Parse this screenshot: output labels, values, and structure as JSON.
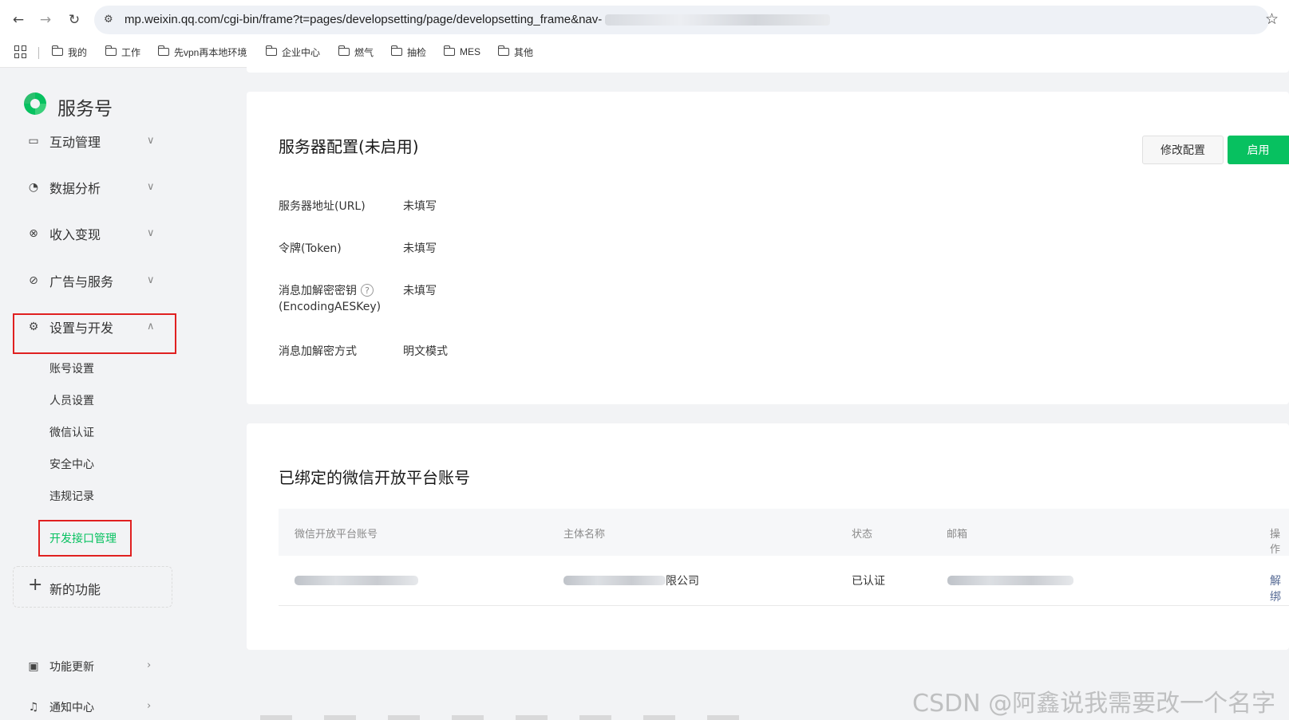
{
  "browser": {
    "url": "mp.weixin.qq.com/cgi-bin/frame?t=pages/developsetting/page/developsetting_frame&nav-",
    "bookmarks": [
      "我的",
      "工作",
      "先vpn再本地环境",
      "企业中心",
      "燃气",
      "抽检",
      "MES",
      "其他"
    ]
  },
  "sidebar": {
    "brand": "服务号",
    "menu": [
      {
        "label": "互动管理",
        "icon": "chat-icon"
      },
      {
        "label": "数据分析",
        "icon": "pie-chart-icon"
      },
      {
        "label": "收入变现",
        "icon": "yen-icon"
      },
      {
        "label": "广告与服务",
        "icon": "compass-icon"
      },
      {
        "label": "设置与开发",
        "icon": "gear-icon"
      }
    ],
    "submenu": [
      "账号设置",
      "人员设置",
      "微信认证",
      "安全中心",
      "违规记录",
      "开发接口管理"
    ],
    "new_function": "新的功能",
    "bottom": [
      {
        "label": "功能更新",
        "icon": "document-icon"
      },
      {
        "label": "通知中心",
        "icon": "bell-icon"
      }
    ]
  },
  "server_config": {
    "title": "服务器配置(未启用)",
    "edit_label": "修改配置",
    "enable_label": "启用",
    "rows": [
      {
        "label": "服务器地址(URL)",
        "value": "未填写"
      },
      {
        "label": "令牌(Token)",
        "value": "未填写"
      },
      {
        "label": "消息加解密密钥",
        "label2": "(EncodingAESKey)",
        "value": "未填写"
      },
      {
        "label": "消息加解密方式",
        "value": "明文模式"
      }
    ]
  },
  "bound_accounts": {
    "title": "已绑定的微信开放平台账号",
    "columns": [
      "微信开放平台账号",
      "主体名称",
      "状态",
      "邮箱",
      "操作"
    ],
    "row": {
      "entity_suffix": "限公司",
      "status": "已认证",
      "action": "解绑"
    }
  },
  "watermark": "CSDN @阿鑫说我需要改一个名字",
  "colors": {
    "accent": "#07c160",
    "highlight": "#e02020"
  }
}
